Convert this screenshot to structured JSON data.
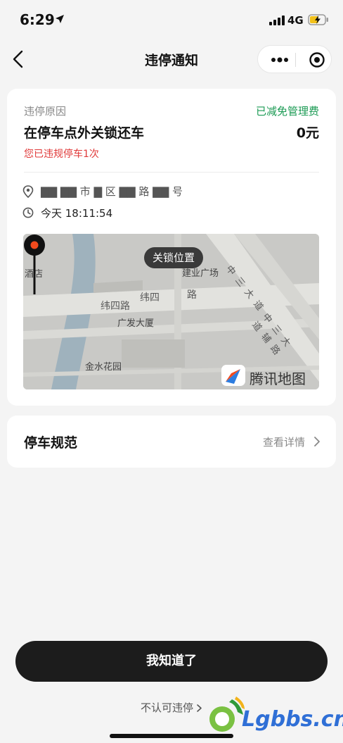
{
  "status_bar": {
    "time": "6:29",
    "network": "4G"
  },
  "nav": {
    "title": "违停通知"
  },
  "violation": {
    "reason_label": "违停原因",
    "fee_status": "已减免管理费",
    "reason": "在停车点外关锁还车",
    "amount": "0元",
    "warning": "您已违规停车1次",
    "address": "▇▇  ▇▇   市 ▇ 区 ▇▇ 路 ▇▇  号",
    "time": "今天 18:11:54"
  },
  "map": {
    "lock_label": "关锁位置",
    "roads": [
      "纬四路",
      "纬四",
      "路",
      "中 三 大 道",
      "中 三 大 道 辅 路"
    ],
    "pois": [
      "建业广场",
      "广发大厦",
      "金水花园",
      "酒店"
    ],
    "provider": "腾讯地图"
  },
  "rules": {
    "title": "停车规范",
    "link": "查看详情"
  },
  "actions": {
    "primary": "我知道了",
    "dispute": "不认可违停"
  },
  "watermark": "Lgbbs.cn",
  "colors": {
    "accent_green": "#1a9a53",
    "warning_red": "#e03a3a",
    "button_dark": "#1c1c1c"
  }
}
